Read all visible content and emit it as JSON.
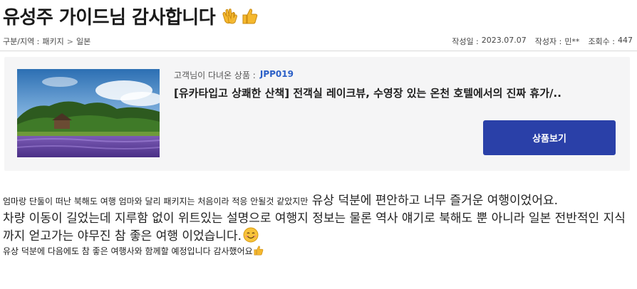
{
  "post": {
    "title": "유성주 가이드님 감사합니다",
    "title_emojis": [
      "clapping-hands-icon",
      "thumbs-up-icon"
    ]
  },
  "breadcrumb": {
    "label": "구분/지역 :",
    "category": "패키지",
    "separator": ">",
    "region": "일본"
  },
  "meta": {
    "date_label": "작성일 :",
    "date": "2023.07.07",
    "author_label": "작성자 :",
    "author": "민**",
    "views_label": "조회수 :",
    "views": "447"
  },
  "product": {
    "subtitle_label": "고객님이 다녀온 상품 :",
    "code": "JPP019",
    "title": "[유카타입고 상쾌한 산책] 전객실 레이크뷰, 수영장 있는 온천 호텔에서의 진짜 휴가/..",
    "button_label": "상품보기"
  },
  "body": {
    "p1_small": "엄마랑 단둘이 떠난 북해도 여행 엄마와 달리 패키지는 처음이라 적응 안될것 같았지만",
    "p1_large": " 유상 덕분에 편안하고  너무 즐거운 여행이었어요.",
    "p2": "차량 이동이 길었는데 지루함 없이 위트있는 설명으로 여행지 정보는 물론 역사 얘기로 북해도 뿐 아니라 일본 전반적인 지식까지 얻고가는 야무진 참 좋은 여행 이었습니다.",
    "p3": "유상 덕분에 다음에도 참 좋은 여행사와 함께할 예정입니다  감사했어요"
  },
  "colors": {
    "accent": "#2a40a8",
    "code": "#2b5fc7",
    "panel": "#f5f5f6"
  }
}
